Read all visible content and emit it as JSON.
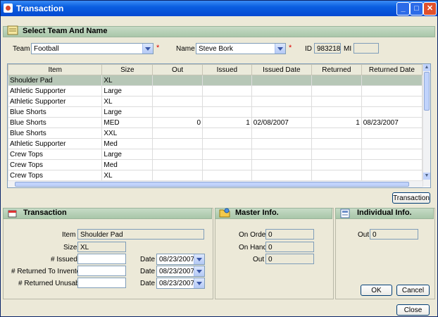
{
  "window": {
    "title": "Transaction"
  },
  "select_section": {
    "title": "Select Team And Name",
    "team_label": "Team",
    "team_value": "Football",
    "name_label": "Name",
    "name_value": "Steve Bork",
    "id_label": "ID",
    "id_value": "983218",
    "mi_label": "MI",
    "mi_value": "",
    "required_mark": "*"
  },
  "grid": {
    "columns": [
      "Item",
      "Size",
      "Out",
      "Issued",
      "Issued Date",
      "Returned",
      "Returned Date"
    ],
    "rows": [
      [
        "Shoulder Pad",
        "XL",
        "",
        "",
        "",
        "",
        ""
      ],
      [
        "Athletic Supporter",
        "Large",
        "",
        "",
        "",
        "",
        ""
      ],
      [
        "Athletic Supporter",
        "XL",
        "",
        "",
        "",
        "",
        ""
      ],
      [
        "Blue Shorts",
        "Large",
        "",
        "",
        "",
        "",
        ""
      ],
      [
        "Blue Shorts",
        "MED",
        "0",
        "1",
        "02/08/2007",
        "1",
        "08/23/2007"
      ],
      [
        "Blue Shorts",
        "XXL",
        "",
        "",
        "",
        "",
        ""
      ],
      [
        "Athletic Supporter",
        "Med",
        "",
        "",
        "",
        "",
        ""
      ],
      [
        "Crew Tops",
        "Large",
        "",
        "",
        "",
        "",
        ""
      ],
      [
        "Crew Tops",
        "Med",
        "",
        "",
        "",
        "",
        ""
      ],
      [
        "Crew Tops",
        "XL",
        "",
        "",
        "",
        "",
        ""
      ]
    ],
    "selected_row": 0
  },
  "transaction_button": "Transaction",
  "transaction_section": {
    "title": "Transaction",
    "item_label": "Item",
    "item_value": "Shoulder Pad",
    "size_label": "Size",
    "size_value": "XL",
    "issued_label": "# Issued",
    "issued_value": "",
    "returned_inv_label": "# Returned To Inventory",
    "returned_inv_value": "",
    "returned_unusable_label": "# Returned Unusable",
    "returned_unusable_value": "",
    "date_label": "Date",
    "date1": "08/23/2007",
    "date2": "08/23/2007",
    "date3": "08/23/2007"
  },
  "master_section": {
    "title": "Master Info.",
    "on_order_label": "On Order",
    "on_order_value": "0",
    "on_hand_label": "On Hand",
    "on_hand_value": "0",
    "out_label": "Out",
    "out_value": "0"
  },
  "individual_section": {
    "title": "Individual Info.",
    "out_label": "Out",
    "out_value": "0"
  },
  "buttons": {
    "ok": "OK",
    "cancel": "Cancel",
    "close": "Close"
  },
  "colors": {
    "title_bar": "#0549d1",
    "section_header": "#a9c6a9",
    "selected_row": "#b7c7b7",
    "required": "#dd0000"
  }
}
